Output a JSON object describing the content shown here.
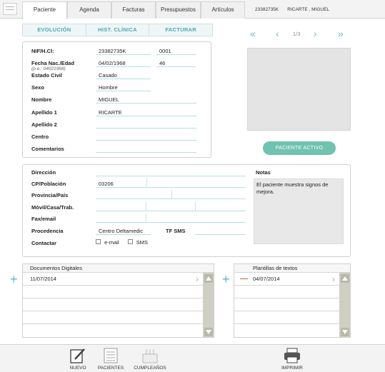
{
  "tabs": [
    "Paciente",
    "Agenda",
    "Facturas",
    "Presupuestos",
    "Artículos"
  ],
  "patient_header": {
    "id": "23382735K",
    "name": "RICARTE , MIGUEL"
  },
  "segments": [
    "EVOLUCIÓN",
    "HIST. CLÍNICA",
    "FACTURAR"
  ],
  "pager": {
    "label": "1/3"
  },
  "form": {
    "nif_label": "NIF/H.Cl:",
    "nif_value": "23382735K",
    "hc_value": "0001",
    "fecha_label": "Fecha Nac./Edad",
    "fecha_hint": "(p.e.: 04021968)",
    "fecha_value": "04/02/1968",
    "edad_value": "46",
    "estado_label": "Estado Civil",
    "estado_value": "Casado",
    "sexo_label": "Sexo",
    "sexo_value": "Hombre",
    "nombre_label": "Nombre",
    "nombre_value": "MIGUEL",
    "ap1_label": "Apellido 1",
    "ap1_value": "RICARTE",
    "ap2_label": "Apellido 2",
    "centro_label": "Centro",
    "coment_label": "Comentarios"
  },
  "active_button": "PACIENTE ACTIVO",
  "contact": {
    "dir_label": "Dirección",
    "cp_label": "CP/Población",
    "cp_value": "03206",
    "prov_label": "Provincia/País",
    "movil_label": "Móvil/Casa/Trab.",
    "fax_label": "Fax/email",
    "proc_label": "Procedencia",
    "proc_value": "Centro Deltamedic",
    "tfsms_label": "TF SMS",
    "contactar_label": "Contactar",
    "email_label": "e-mail",
    "sms_label": "SMS"
  },
  "notes": {
    "title": "Notas",
    "text": "El paciente muestra signos de mejora."
  },
  "docs": {
    "title": "Documentos Digitales",
    "rows": [
      "11/07/2014"
    ]
  },
  "templates": {
    "title": "Plantillas de textos",
    "rows": [
      "04/07/2014"
    ]
  },
  "toolbar": [
    "NUEVO",
    "PACIENTES",
    "CUMPLEAÑOS",
    "IMPRIMIR"
  ],
  "colors": {
    "accent": "#5cb7c0",
    "pill": "#6fc3b0"
  }
}
